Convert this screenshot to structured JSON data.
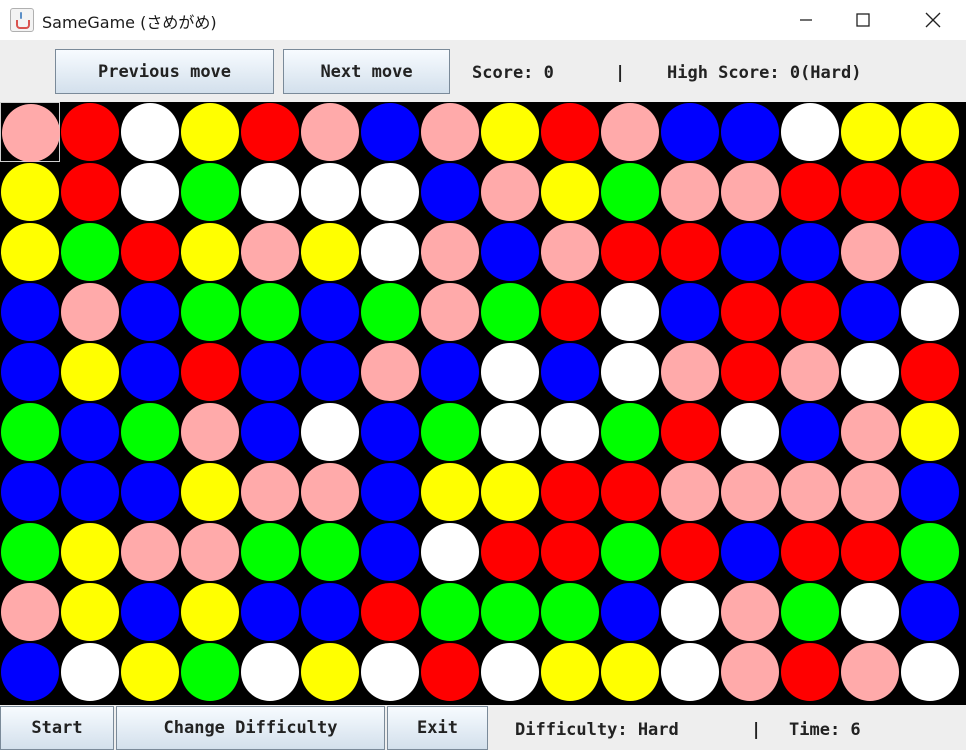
{
  "window": {
    "title": "SameGame (さめがめ)"
  },
  "toolbar": {
    "previous_label": "Previous move",
    "next_label": "Next move",
    "score_text": "Score: 0",
    "separator": "|",
    "high_score_text": "High Score: 0(Hard)"
  },
  "footer": {
    "start_label": "Start",
    "change_difficulty_label": "Change Difficulty",
    "exit_label": "Exit",
    "difficulty_text": "Difficulty: Hard",
    "separator": "|",
    "time_text": "Time: 6"
  },
  "board": {
    "rows": 10,
    "cols": 16,
    "selected": {
      "row": 0,
      "col": 0
    },
    "colors": {
      "P": "#ffaaaa",
      "R": "#ff0000",
      "W": "#ffffff",
      "Y": "#ffff00",
      "B": "#0000ff",
      "G": "#00ff00"
    },
    "grid": [
      "PRWYRPBPYRPBBWYY",
      "YRWGWWWBPYGPPRRR",
      "YGRYPYWPBPRRBBPB",
      "BPBGGBGPGRWBRRBW",
      "BYBRBBPBWBWPRPWR",
      "GBGPBWBGWWGRWBPY",
      "BBBYPPBYYRRPPPPB",
      "GYPPGGBWRRGRBRRG",
      "PYBYBBRGGGBWPGWB",
      "BWYGWYWRWYYWPRPW"
    ]
  }
}
